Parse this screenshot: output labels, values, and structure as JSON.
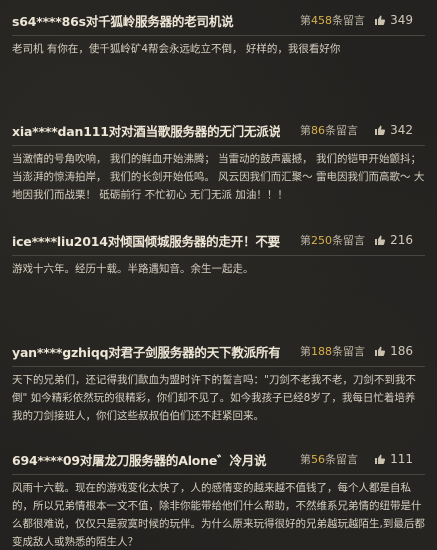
{
  "posts": [
    {
      "title": "s64****86s对千狐岭服务器的老司机说",
      "count_prefix": "第",
      "count_num": "458",
      "count_suffix": "条留言",
      "likes": "349",
      "body": "老司机 有你在，使千狐岭矿4帮会永远屹立不倒， 好样的，我很看好你"
    },
    {
      "title": "xia****dan111对对酒当歌服务器的无门无派说",
      "count_prefix": "第",
      "count_num": "86",
      "count_suffix": "条留言",
      "likes": "342",
      "body": "当激情的号角吹响， 我们的鲜血开始沸腾； 当雷动的鼓声震撼， 我们的铠甲开始颤抖；当澎湃的惊涛拍岸， 我们的长剑开始低鸣。 风云因我们而汇聚～ 雷电因我们而高歌～ 大地因我们而战栗！ 砥砺前行 不忙初心 无门无派 加油！！！"
    },
    {
      "title": "ice****liu2014对倾国倾城服务器的走开！不要闹...",
      "count_prefix": "第",
      "count_num": "250",
      "count_suffix": "条留言",
      "likes": "216",
      "body": "游戏十六年。经历十载。半路遇知音。余生一起走。"
    },
    {
      "title": "yan****gzhiqq对君子剑服务器的天下教派所有兄...",
      "count_prefix": "第",
      "count_num": "188",
      "count_suffix": "条留言",
      "likes": "186",
      "body": "天下的兄弟们，还记得我们歃血为盟时许下的誓言吗：\"刀剑不老我不老，刀剑不到我不倒\" 如今精彩依然玩的很精彩，你们却不见了。如今我孩子已经8岁了，我每日忙着培养我的刀剑接班人，你们这些叔叔伯伯们还不赶紧回来。"
    },
    {
      "title": "694****09对屠龙刀服务器的Alone゛冷月说",
      "count_prefix": "第",
      "count_num": "56",
      "count_suffix": "条留言",
      "likes": "111",
      "body": "风雨十六载。现在的游戏变化太快了，人的感情变的越来越不值钱了，每个人都是自私的，所以兄弟情根本一文不值，除非你能带给他们什么帮助，不然维系兄弟情的纽带是什么都很难说，仅仅只是寂寞时候的玩伴。为什么原来玩得很好的兄弟越玩越陌生,到最后都变成敌人或熟悉的陌生人？"
    }
  ],
  "icons": {
    "likes": "thumbs-up-icon"
  },
  "colors": {
    "count_number": "#d9b04a",
    "background": "#232220"
  }
}
